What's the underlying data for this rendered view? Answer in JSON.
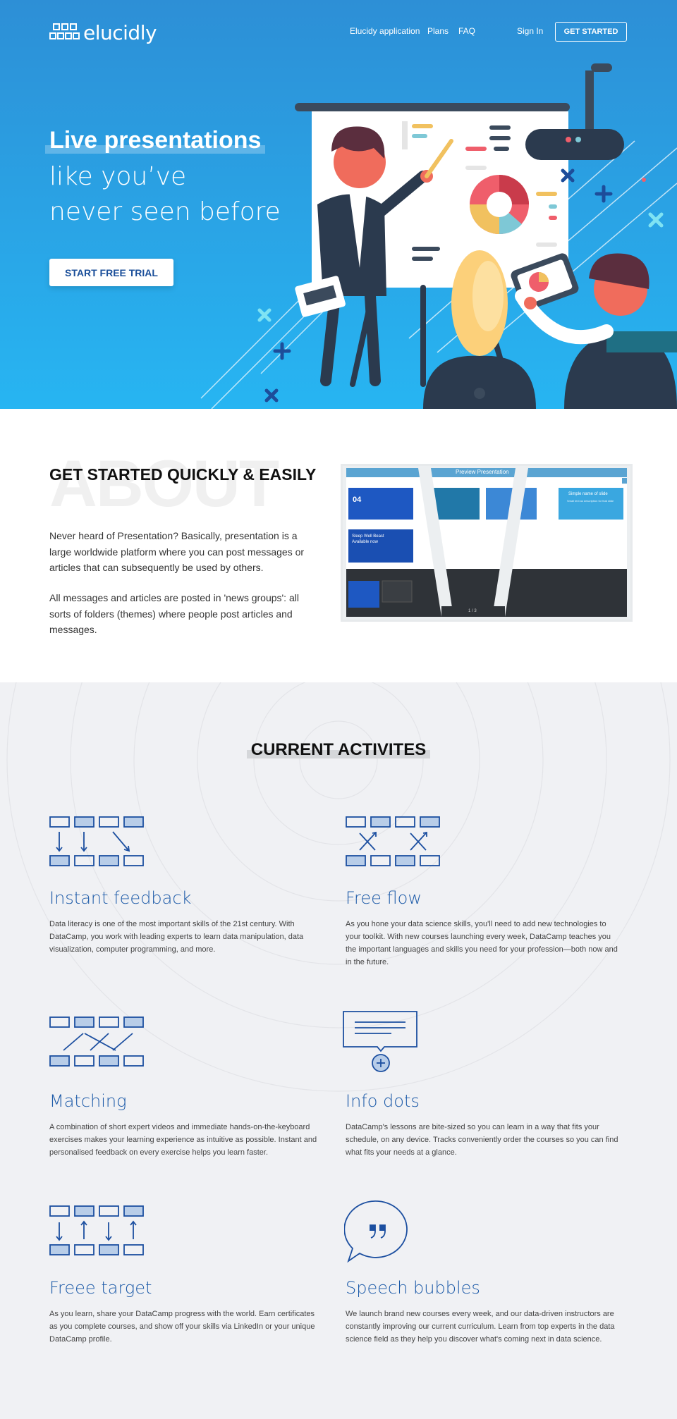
{
  "header": {
    "logo": "elucidly",
    "nav": [
      "Elucidy application",
      "Plans",
      "FAQ"
    ],
    "sign_in": "Sign In",
    "get_started": "GET STARTED"
  },
  "hero": {
    "title": "Live presentations",
    "subtitle_1": "like you’ve",
    "subtitle_2": "never seen before",
    "cta": "START FREE TRIAL"
  },
  "about": {
    "bg_word": "ABOUT",
    "title": "GET STARTED QUICKLY & EASILY",
    "p1": "Never heard of Presentation? Basically, presentation is a large worldwide platform where you can post messages or articles that can subsequently be used by others.",
    "p2": "All messages and articles are posted in 'news groups': all sorts of folders (themes) where people post articles and messages.",
    "preview": {
      "title": "Preview Presentation",
      "slide_num": "04",
      "slide_caption": "Sleep Well Beast Available now",
      "slide_name": "Simple name of slide",
      "slide_desc": "Small text as description for that slide",
      "pager": "1 / 3"
    }
  },
  "activities": {
    "title": "CURRENT ACTIVITES",
    "items": [
      {
        "title": "Instant feedback",
        "text": "Data literacy is one of the most important skills of the 21st century. With DataCamp, you work with leading experts to learn data manipulation, data visualization, computer programming, and more."
      },
      {
        "title": "Free flow",
        "text": "As you hone your data science skills, you'll need to add new technologies to your toolkit. With new courses launching every week, DataCamp teaches you the important languages and skills you need for your profession—both now and in the future."
      },
      {
        "title": "Matching",
        "text": "A combination of short expert videos and immediate hands-on-the-keyboard exercises makes your learning experience as intuitive as possible. Instant and personalised feedback on every exercise helps you learn faster."
      },
      {
        "title": "Info dots",
        "text": "DataCamp's lessons are bite-sized so you can learn in a way that fits your schedule, on any device. Tracks conveniently order the courses so you can find what fits your needs at a glance."
      },
      {
        "title": "Freee target",
        "text": "As you learn, share your DataCamp progress with the world. Earn certificates as you complete courses, and show off your skills via LinkedIn or your unique DataCamp profile."
      },
      {
        "title": "Speech bubbles",
        "text": "We launch brand new courses every week, and our data-driven instructors are constantly improving our current curriculum. Learn from top experts in the data science field as they help you discover what's coming next in data science."
      }
    ]
  },
  "colors": {
    "hero_top": "#2d8fd6",
    "hero_bottom": "#27b5f2",
    "accent": "#1c5aa8",
    "icon_fill": "#b8cde8"
  }
}
